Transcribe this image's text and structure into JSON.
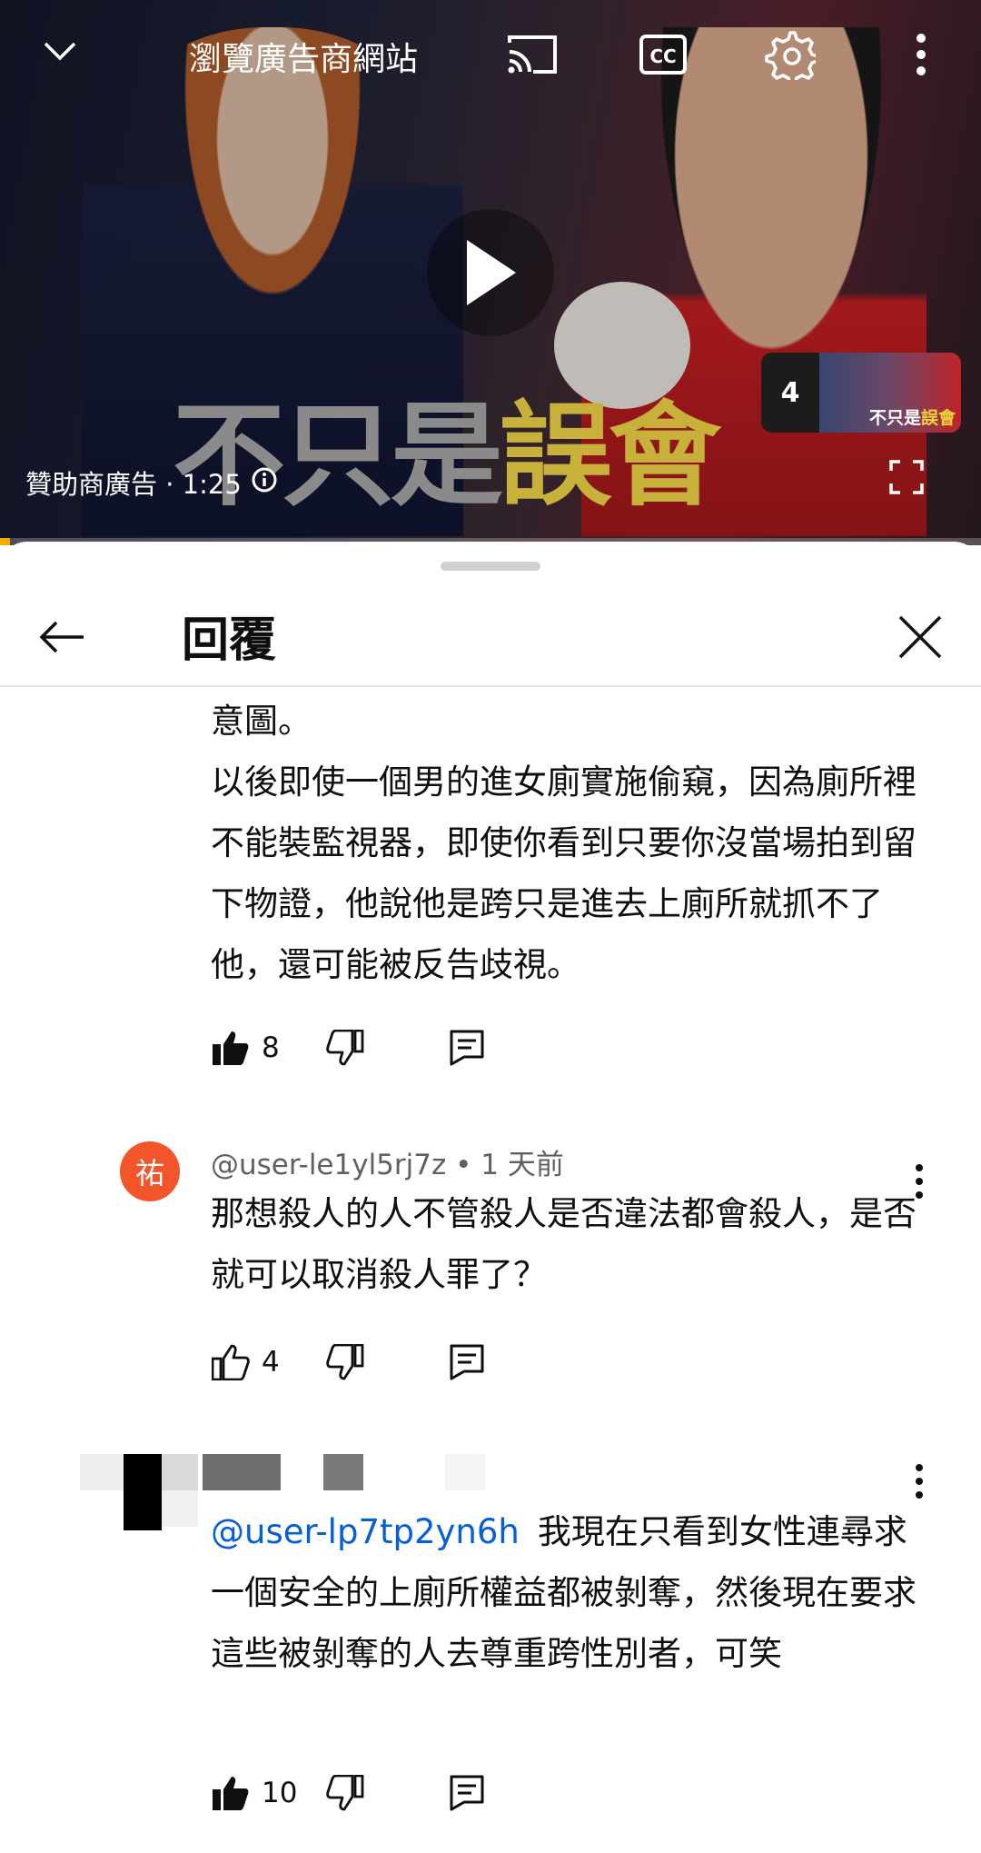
{
  "player": {
    "ad_link": "瀏覽廣告商網站",
    "ad_label": "贊助商廣告 · 1:25",
    "banner_a": "不只是",
    "banner_b": "誤會",
    "thumb_count": "4",
    "thumb_caption_a": "不只是",
    "thumb_caption_b": "誤會",
    "progress": 0.01,
    "icons": [
      "chevron-down-icon",
      "cast-icon",
      "cc-icon",
      "gear-icon",
      "more-vert-icon",
      "play-icon",
      "info-icon",
      "fullscreen-icon"
    ]
  },
  "sheet": {
    "title": "回覆"
  },
  "comments": [
    {
      "text": "意圖。\n以後即使一個男的進女廁實施偷窺，因為廁所裡不能裝監視器，即使你看到只要你沒當場拍到留下物證，他說他是跨只是進去上廁所就抓不了他，還可能被反告歧視。",
      "likes": "8",
      "liked": true
    },
    {
      "avatar_letter": "祐",
      "avatar_color": "#f2552a",
      "author": "@user-le1yl5rj7z",
      "time": "1 天前",
      "text": "那想殺人的人不管殺人是否違法都會殺人，是否就可以取消殺人罪了？",
      "likes": "4",
      "liked": false
    },
    {
      "mention": "@user-lp7tp2yn6h",
      "text": "我現在只看到女性連尋求一個安全的上廁所權益都被剝奪，然後現在要求這些被剝奪的人去尊重跨性別者，可笑",
      "likes": "10",
      "liked": true
    }
  ]
}
